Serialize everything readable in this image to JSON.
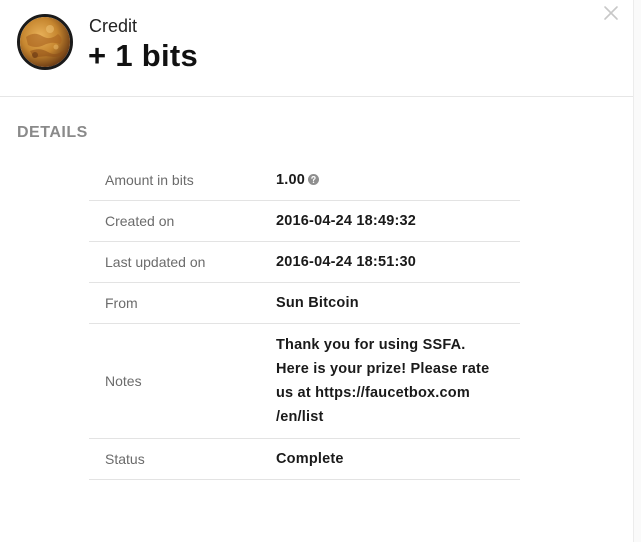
{
  "header": {
    "kind": "Credit",
    "amount": "+ 1 bits",
    "avatar_icon": "planet-avatar-icon",
    "close_icon": "close-icon"
  },
  "details": {
    "title": "DETAILS",
    "rows": [
      {
        "label": "Amount in bits",
        "value": "1.00"
      },
      {
        "label": "Created on",
        "value": "2016-04-24 18:49:32"
      },
      {
        "label": "Last updated on",
        "value": "2016-04-24 18:51:30"
      },
      {
        "label": "From",
        "value": "Sun Bitcoin"
      },
      {
        "label": "Notes",
        "value_lines": [
          "Thank you for using SSFA.",
          "Here is your prize! Please rate",
          "us at https://faucetbox.com",
          "/en/list"
        ]
      },
      {
        "label": "Status",
        "value": "Complete"
      }
    ]
  },
  "colors": {
    "section_title": "#8a8a8a",
    "label": "#6b6b6b",
    "divider": "#e3e3e3",
    "avatar_border": "#1a1a1a",
    "avatar_fill": "#c6862f"
  }
}
